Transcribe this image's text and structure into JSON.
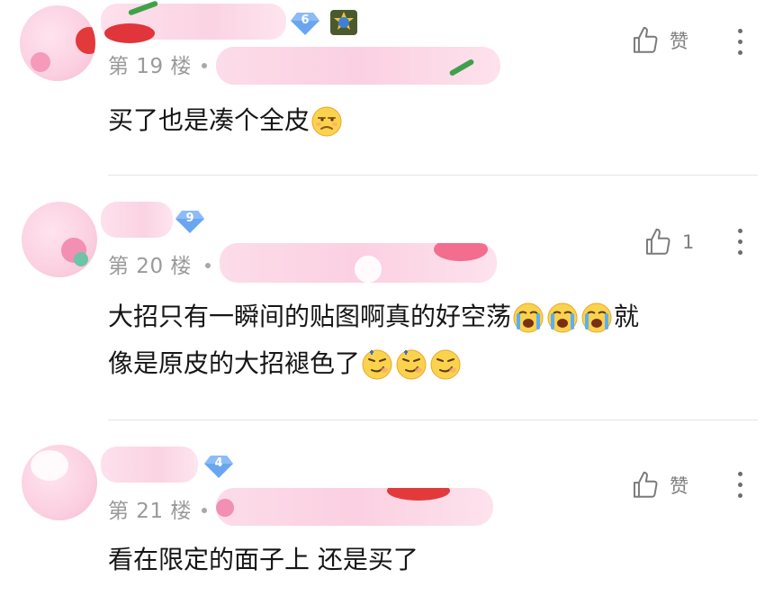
{
  "posts": [
    {
      "level": "6",
      "floor": "第 19 楼",
      "like_label": "赞",
      "text": "买了也是凑个全皮",
      "trailing_emojis": [
        "unamused-face-emoji"
      ]
    },
    {
      "level": "9",
      "floor": "第 20 楼",
      "like_label": "1",
      "text_line1": "大招只有一瞬间的贴图啊真的好空荡",
      "text_line1_emojis": [
        "crying-face-emoji",
        "crying-face-emoji",
        "crying-face-emoji"
      ],
      "text_line1_tail": "就",
      "text_line2": "像是原皮的大招褪色了",
      "text_line2_emojis": [
        "smirk-face-emoji",
        "smirk-face-emoji",
        "smirk-face-emoji"
      ]
    },
    {
      "level": "4",
      "floor": "第 21 楼",
      "like_label": "赞",
      "text": "看在限定的面子上 还是买了"
    }
  ],
  "colors": {
    "level_badge": "#6aa6f0",
    "floor_text": "#9a9a9a",
    "divider": "#e4e4e4",
    "blur_pink": "#fbd0e2"
  }
}
